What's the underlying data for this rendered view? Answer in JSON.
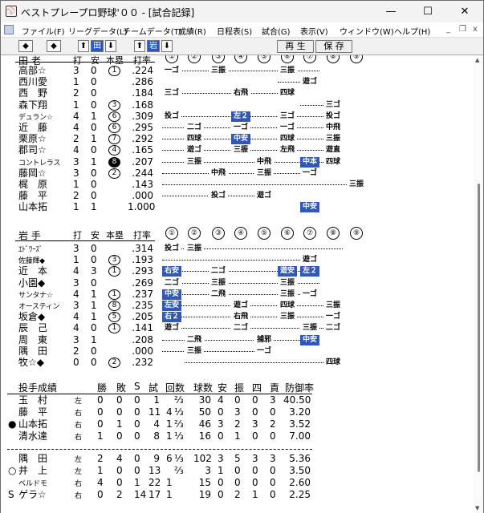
{
  "window": {
    "title": "ベストプレープロ野球'００ - [試合記録]",
    "app_icon": "baseball-cap-icon",
    "controls": {
      "minimize": "—",
      "maximize": "☐",
      "close": "✕"
    }
  },
  "menu": [
    "ファイル(F)",
    "リーグデータ(L)",
    "チームデータ(T)",
    "成績(R)",
    "日程表(S)",
    "試合(G)",
    "表示(V)",
    "ウィンドウ(W)",
    "ヘルプ(H)"
  ],
  "mdi_controls": {
    "minimize": "_",
    "restore": "❐",
    "close": "x"
  },
  "toolbar": {
    "left": "◆",
    "right": "◆",
    "up1": "⬆",
    "team1": "田",
    "down1": "⬇",
    "up2": "⬆",
    "team2": "岩",
    "down2": "⬇",
    "replay": "再 生",
    "save": "保 存"
  },
  "team1": {
    "name": "田 老",
    "headers": {
      "h": "打",
      "a": "安",
      "hr": "本塁",
      "avg": "打率"
    },
    "innings": [
      "①",
      "②",
      "③",
      "④",
      "⑤",
      "⑥",
      "⑦",
      "⑧",
      "⑨"
    ],
    "players": [
      {
        "name": "高部☆",
        "ab": "3",
        "h": "0",
        "hr": "1",
        "hr_style": "c",
        "avg": ".224",
        "results": [
          {
            "i": 1,
            "t": "一ゴ"
          },
          {
            "i": 3,
            "t": "三振"
          },
          {
            "i": 6,
            "t": "三振"
          }
        ],
        "last": 7
      },
      {
        "name": "西川愛",
        "ab": "1",
        "h": "0",
        "hr": "",
        "hr_style": "",
        "avg": ".286",
        "results": [
          {
            "i": 7,
            "t": "遊ゴ"
          }
        ],
        "first": 6,
        "last": 7
      },
      {
        "name": "西　野",
        "ab": "2",
        "h": "0",
        "hr": "",
        "hr_style": "",
        "avg": ".184",
        "results": [
          {
            "i": 1,
            "t": "三ゴ"
          },
          {
            "i": 4,
            "t": "右飛"
          },
          {
            "i": 6,
            "t": "四球"
          }
        ],
        "last": 6
      },
      {
        "name": "森下翔",
        "ab": "1",
        "h": "0",
        "hr": "3",
        "hr_style": "c",
        "avg": ".168",
        "results": [
          {
            "i": 8,
            "t": "三ゴ"
          }
        ],
        "first": 7,
        "last": 8
      },
      {
        "name": "デュラン☆",
        "small": true,
        "ab": "4",
        "h": "1",
        "hr": "6",
        "hr_style": "c",
        "avg": ".309",
        "results": [
          {
            "i": 1,
            "t": "投ゴ"
          },
          {
            "i": 4,
            "t": "左２",
            "b": true
          },
          {
            "i": 6,
            "t": "三ゴ"
          },
          {
            "i": 8,
            "t": "投ゴ"
          }
        ],
        "last": 8
      },
      {
        "name": "近　藤",
        "ab": "4",
        "h": "0",
        "hr": "6",
        "hr_style": "c",
        "avg": ".295",
        "results": [
          {
            "i": 2,
            "t": "二ゴ"
          },
          {
            "i": 4,
            "t": "一ゴ"
          },
          {
            "i": 6,
            "t": "一ゴ"
          },
          {
            "i": 8,
            "t": "中飛"
          }
        ],
        "last": 8
      },
      {
        "name": "栗原☆",
        "ab": "2",
        "h": "1",
        "hr": "7",
        "hr_style": "c",
        "avg": ".292",
        "results": [
          {
            "i": 2,
            "t": "四球"
          },
          {
            "i": 4,
            "t": "中安",
            "b": true
          },
          {
            "i": 6,
            "t": "四球"
          },
          {
            "i": 8,
            "t": "三振"
          }
        ],
        "last": 8
      },
      {
        "name": "郡司☆",
        "ab": "4",
        "h": "0",
        "hr": "4",
        "hr_style": "c",
        "avg": ".165",
        "results": [
          {
            "i": 2,
            "t": "遊ゴ"
          },
          {
            "i": 4,
            "t": "三振"
          },
          {
            "i": 6,
            "t": "左飛"
          },
          {
            "i": 8,
            "t": "遊直"
          }
        ],
        "last": 8
      },
      {
        "name": "コントレラス",
        "small": true,
        "ab": "3",
        "h": "1",
        "hr": "8",
        "hr_style": "f",
        "avg": ".207",
        "results": [
          {
            "i": 2,
            "t": "三振"
          },
          {
            "i": 5,
            "t": "中飛"
          },
          {
            "i": 7,
            "t": "中本",
            "b": true
          },
          {
            "i": 8,
            "t": "四球"
          }
        ],
        "last": 8
      },
      {
        "name": "藤岡☆",
        "ab": "3",
        "h": "0",
        "hr": "2",
        "hr_style": "c",
        "avg": ".244",
        "results": [
          {
            "i": 3,
            "t": "中飛"
          },
          {
            "i": 5,
            "t": "三振"
          },
          {
            "i": 7,
            "t": "一ゴ"
          }
        ],
        "last": 7
      },
      {
        "name": "梶　原",
        "ab": "1",
        "h": "0",
        "hr": "",
        "hr_style": "",
        "avg": ".143",
        "results": [
          {
            "i": 9,
            "t": "三振"
          }
        ],
        "last": 9
      },
      {
        "name": "藤　平",
        "ab": "2",
        "h": "0",
        "hr": "",
        "hr_style": "",
        "avg": ".000",
        "results": [
          {
            "i": 3,
            "t": "投ゴ"
          },
          {
            "i": 5,
            "t": "遊ゴ"
          }
        ],
        "last": 5
      },
      {
        "name": "山本拓",
        "ab": "1",
        "h": "1",
        "hr": "",
        "hr_style": "",
        "avg": "1.000",
        "results": [
          {
            "i": 7,
            "t": "中安",
            "b": true
          }
        ],
        "first": 7,
        "last": 7
      }
    ]
  },
  "team2": {
    "name": "岩 手",
    "headers": {
      "ab": "打",
      "h": "安",
      "hr": "本塁",
      "avg": "打率"
    },
    "innings": [
      "①",
      "②",
      "③",
      "④",
      "⑤",
      "⑥",
      "⑦",
      "⑧",
      "⑨"
    ],
    "players": [
      {
        "name": "ｴﾄﾞﾜｰｽﾞ",
        "small": true,
        "ab": "3",
        "h": "0",
        "hr": "",
        "hr_style": "",
        "avg": ".314",
        "results": [
          {
            "i": 1,
            "t": "投ゴ"
          },
          {
            "i": 2,
            "t": "三振"
          }
        ],
        "last": 8
      },
      {
        "name": "佐藤輝◆",
        "small": true,
        "ab": "1",
        "h": "0",
        "hr": "3",
        "hr_style": "c",
        "avg": ".193",
        "results": [
          {
            "i": 7,
            "t": "遊ゴ"
          }
        ],
        "last": 7
      },
      {
        "name": "近　本",
        "ab": "4",
        "h": "3",
        "hr": "1",
        "hr_style": "c",
        "avg": ".293",
        "results": [
          {
            "i": 1,
            "t": "右安",
            "b": true
          },
          {
            "i": 3,
            "t": "二ゴ"
          },
          {
            "i": 6,
            "t": "遊安",
            "b": true
          },
          {
            "i": 7,
            "t": "左２",
            "b": true
          }
        ],
        "last": 7
      },
      {
        "name": "小園◆",
        "ab": "3",
        "h": "0",
        "hr": "",
        "hr_style": "",
        "avg": ".269",
        "results": [
          {
            "i": 1,
            "t": "二ゴ"
          },
          {
            "i": 3,
            "t": "三振"
          },
          {
            "i": 6,
            "t": "三振"
          }
        ],
        "last": 7
      },
      {
        "name": "サンタナ☆",
        "small": true,
        "ab": "4",
        "h": "1",
        "hr": "1",
        "hr_style": "c",
        "avg": ".237",
        "results": [
          {
            "i": 1,
            "t": "中安",
            "b": true
          },
          {
            "i": 3,
            "t": "二飛"
          },
          {
            "i": 6,
            "t": "三振"
          },
          {
            "i": 7,
            "t": "一ゴ"
          }
        ],
        "last": 7
      },
      {
        "name": "オースティン",
        "small": true,
        "ab": "3",
        "h": "1",
        "hr": "8",
        "hr_style": "c",
        "avg": ".235",
        "results": [
          {
            "i": 1,
            "t": "左安",
            "b": true
          },
          {
            "i": 4,
            "t": "遊ゴ"
          },
          {
            "i": 6,
            "t": "四球"
          },
          {
            "i": 8,
            "t": "三振"
          }
        ],
        "last": 8
      },
      {
        "name": "坂倉◆",
        "ab": "4",
        "h": "1",
        "hr": "5",
        "hr_style": "c",
        "avg": ".205",
        "results": [
          {
            "i": 1,
            "t": "右２",
            "b": true
          },
          {
            "i": 4,
            "t": "右飛"
          },
          {
            "i": 6,
            "t": "三振"
          },
          {
            "i": 8,
            "t": "一ゴ"
          }
        ],
        "last": 8
      },
      {
        "name": "辰　己",
        "ab": "4",
        "h": "0",
        "hr": "1",
        "hr_style": "c",
        "avg": ".141",
        "results": [
          {
            "i": 1,
            "t": "遊ゴ"
          },
          {
            "i": 4,
            "t": "二ゴ"
          },
          {
            "i": 7,
            "t": "三振"
          },
          {
            "i": 8,
            "t": "二ゴ"
          }
        ],
        "last": 8
      },
      {
        "name": "周　東",
        "ab": "3",
        "h": "1",
        "hr": "",
        "hr_style": "",
        "avg": ".208",
        "results": [
          {
            "i": 2,
            "t": "二飛"
          },
          {
            "i": 5,
            "t": "捕邪"
          },
          {
            "i": 7,
            "t": "中安",
            "b": true
          }
        ],
        "last": 7
      },
      {
        "name": "隅　田",
        "ab": "2",
        "h": "0",
        "hr": "",
        "hr_style": "",
        "avg": ".000",
        "results": [
          {
            "i": 2,
            "t": "三振"
          },
          {
            "i": 5,
            "t": "一ゴ"
          }
        ],
        "last": 5
      },
      {
        "name": "牧☆◆",
        "ab": "0",
        "h": "0",
        "hr": "2",
        "hr_style": "c",
        "avg": ".232",
        "results": [
          {
            "i": 8,
            "t": "四球"
          }
        ],
        "first": 2,
        "last": 8
      }
    ]
  },
  "pitching": {
    "title": "投手成績",
    "headers": [
      "勝",
      "敗",
      "S",
      "試",
      "回数",
      "球数",
      "安",
      "振",
      "四",
      "責",
      "防御率"
    ],
    "team1": [
      {
        "mark": "",
        "name": "玉　村",
        "hand": "左",
        "w": "0",
        "l": "0",
        "s": "0",
        "g": "1",
        "ip": "",
        "ipf": "⅔",
        "pc": "30",
        "h": "4",
        "k": "0",
        "bb": "0",
        "er": "3",
        "era": "40.50"
      },
      {
        "mark": "",
        "name": "藤　平",
        "hand": "右",
        "w": "0",
        "l": "0",
        "s": "0",
        "g": "11",
        "ip": "4",
        "ipf": "⅓",
        "pc": "50",
        "h": "0",
        "k": "3",
        "bb": "0",
        "er": "0",
        "era": "3.20"
      },
      {
        "mark": "●",
        "name": "山本拓",
        "hand": "右",
        "w": "0",
        "l": "1",
        "s": "0",
        "g": "4",
        "ip": "1",
        "ipf": "⅔",
        "pc": "46",
        "h": "3",
        "k": "2",
        "bb": "3",
        "er": "2",
        "era": "3.52"
      },
      {
        "mark": "",
        "name": "清水達",
        "hand": "右",
        "w": "1",
        "l": "0",
        "s": "0",
        "g": "8",
        "ip": "1",
        "ipf": "⅓",
        "pc": "16",
        "h": "0",
        "k": "1",
        "bb": "0",
        "er": "0",
        "era": "7.00"
      }
    ],
    "team2": [
      {
        "mark": "",
        "name": "隅　田",
        "hand": "左",
        "w": "2",
        "l": "4",
        "s": "0",
        "g": "9",
        "ip": "6",
        "ipf": "⅓",
        "pc": "102",
        "h": "3",
        "k": "5",
        "bb": "3",
        "er": "3",
        "era": "5.36"
      },
      {
        "mark": "○",
        "name": "井　上",
        "hand": "左",
        "w": "1",
        "l": "0",
        "s": "0",
        "g": "13",
        "ip": "",
        "ipf": "⅔",
        "pc": "3",
        "h": "1",
        "k": "0",
        "bb": "0",
        "er": "0",
        "era": "3.50"
      },
      {
        "mark": "",
        "name": "ベルドモ",
        "small": true,
        "hand": "右",
        "w": "4",
        "l": "0",
        "s": "1",
        "g": "22",
        "ip": "1",
        "ipf": "",
        "pc": "15",
        "h": "0",
        "k": "0",
        "bb": "0",
        "er": "0",
        "era": "2.60"
      },
      {
        "mark": "S",
        "name": "ゲラ☆",
        "hand": "右",
        "w": "0",
        "l": "2",
        "s": "14",
        "g": "17",
        "ip": "1",
        "ipf": "",
        "pc": "19",
        "h": "0",
        "k": "2",
        "bb": "1",
        "er": "0",
        "era": "2.25"
      }
    ]
  }
}
